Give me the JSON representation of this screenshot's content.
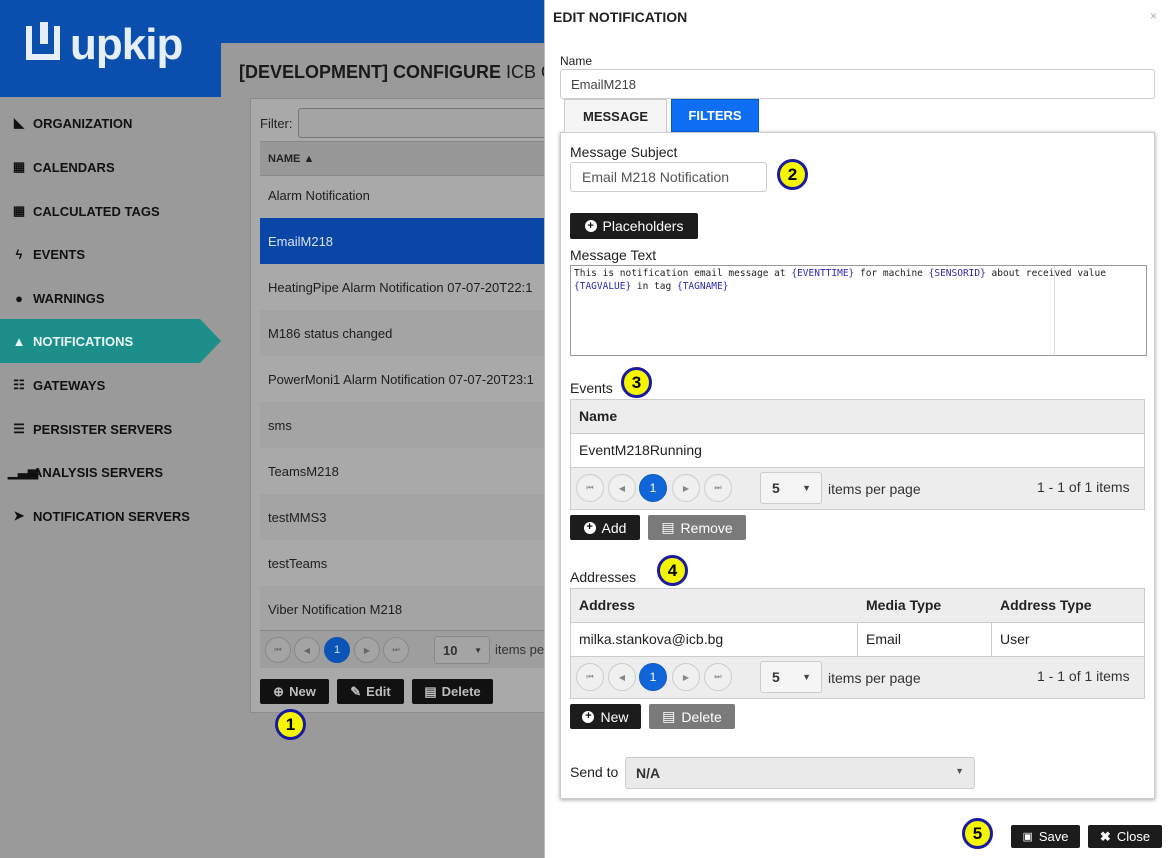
{
  "app": {
    "brand": "upkip"
  },
  "sidebar": {
    "items": [
      {
        "label": "ORGANIZATION",
        "icon": "area-chart-icon",
        "glyph": "◣"
      },
      {
        "label": "CALENDARS",
        "icon": "calendar-icon",
        "glyph": "▦"
      },
      {
        "label": "CALCULATED TAGS",
        "icon": "calculator-icon",
        "glyph": "▦"
      },
      {
        "label": "EVENTS",
        "icon": "bolt-icon",
        "glyph": "ϟ"
      },
      {
        "label": "WARNINGS",
        "icon": "exclamation-circle-icon",
        "glyph": "●"
      },
      {
        "label": "NOTIFICATIONS",
        "icon": "bell-icon",
        "glyph": "▲",
        "active": true
      },
      {
        "label": "GATEWAYS",
        "icon": "sitemap-icon",
        "glyph": "☷"
      },
      {
        "label": "PERSISTER SERVERS",
        "icon": "server-icon",
        "glyph": "☰"
      },
      {
        "label": "ANALYSIS SERVERS",
        "icon": "bar-chart-icon",
        "glyph": "▁▃▅"
      },
      {
        "label": "NOTIFICATION SERVERS",
        "icon": "paper-plane-icon",
        "glyph": "➤"
      }
    ]
  },
  "main": {
    "title_bold": "[DEVELOPMENT] CONFIGURE",
    "title_rest": " ICB O",
    "filter_label": "Filter:",
    "grid": {
      "column": "NAME ▲",
      "rows": [
        "Alarm Notification",
        "EmailM218",
        "HeatingPipe Alarm Notification 07-07-20T22:1",
        "M186 status changed",
        "PowerMoni1 Alarm Notification 07-07-20T23:1",
        "sms",
        "TeamsM218",
        "testMMS3",
        "testTeams",
        "Viber Notification M218"
      ],
      "selected_index": 1
    },
    "pager": {
      "current": "1",
      "page_size": "10",
      "items_per_page": "items pe"
    },
    "buttons": {
      "new": "New",
      "edit": "Edit",
      "delete": "Delete"
    }
  },
  "badges": [
    "1",
    "2",
    "3",
    "4",
    "5"
  ],
  "modal": {
    "title": "EDIT NOTIFICATION",
    "close_glyph": "×",
    "name_label": "Name",
    "name_value": "EmailM218",
    "tabs": [
      "MESSAGE",
      "FILTERS"
    ],
    "subject_label": "Message Subject",
    "subject_value": "Email M218 Notification",
    "placeholders_label": "Placeholders",
    "message_text_label": "Message Text",
    "message_text": {
      "p1": "This is notification email message at ",
      "t1": "{EVENTTIME}",
      "p2": " for machine ",
      "t2": "{SENSORID}",
      "p3": " about received value ",
      "t3": "{TAGVALUE}",
      "p4": " in tag ",
      "t4": "{TAGNAME}"
    },
    "events": {
      "label": "Events",
      "columns": [
        "Name"
      ],
      "rows": [
        [
          "EventM218Running"
        ]
      ],
      "pager": {
        "current": "1",
        "page_size": "5",
        "items_per_page": "items per page",
        "count": "1 - 1 of 1 items"
      },
      "add": "Add",
      "remove": "Remove"
    },
    "addresses": {
      "label": "Addresses",
      "columns": [
        "Address",
        "Media Type",
        "Address Type"
      ],
      "rows": [
        [
          "milka.stankova@icb.bg",
          "Email",
          "User"
        ]
      ],
      "pager": {
        "current": "1",
        "page_size": "5",
        "items_per_page": "items per page",
        "count": "1 - 1 of 1 items"
      },
      "new": "New",
      "delete": "Delete"
    },
    "send_to_label": "Send to",
    "send_to_value": "N/A",
    "save": "Save",
    "close": "Close"
  },
  "colors": {
    "brand_blue": "#0a4fae",
    "active_teal": "#1d8f8a",
    "tab_blue": "#0f6ff4",
    "badge_yellow": "#f5f500"
  }
}
